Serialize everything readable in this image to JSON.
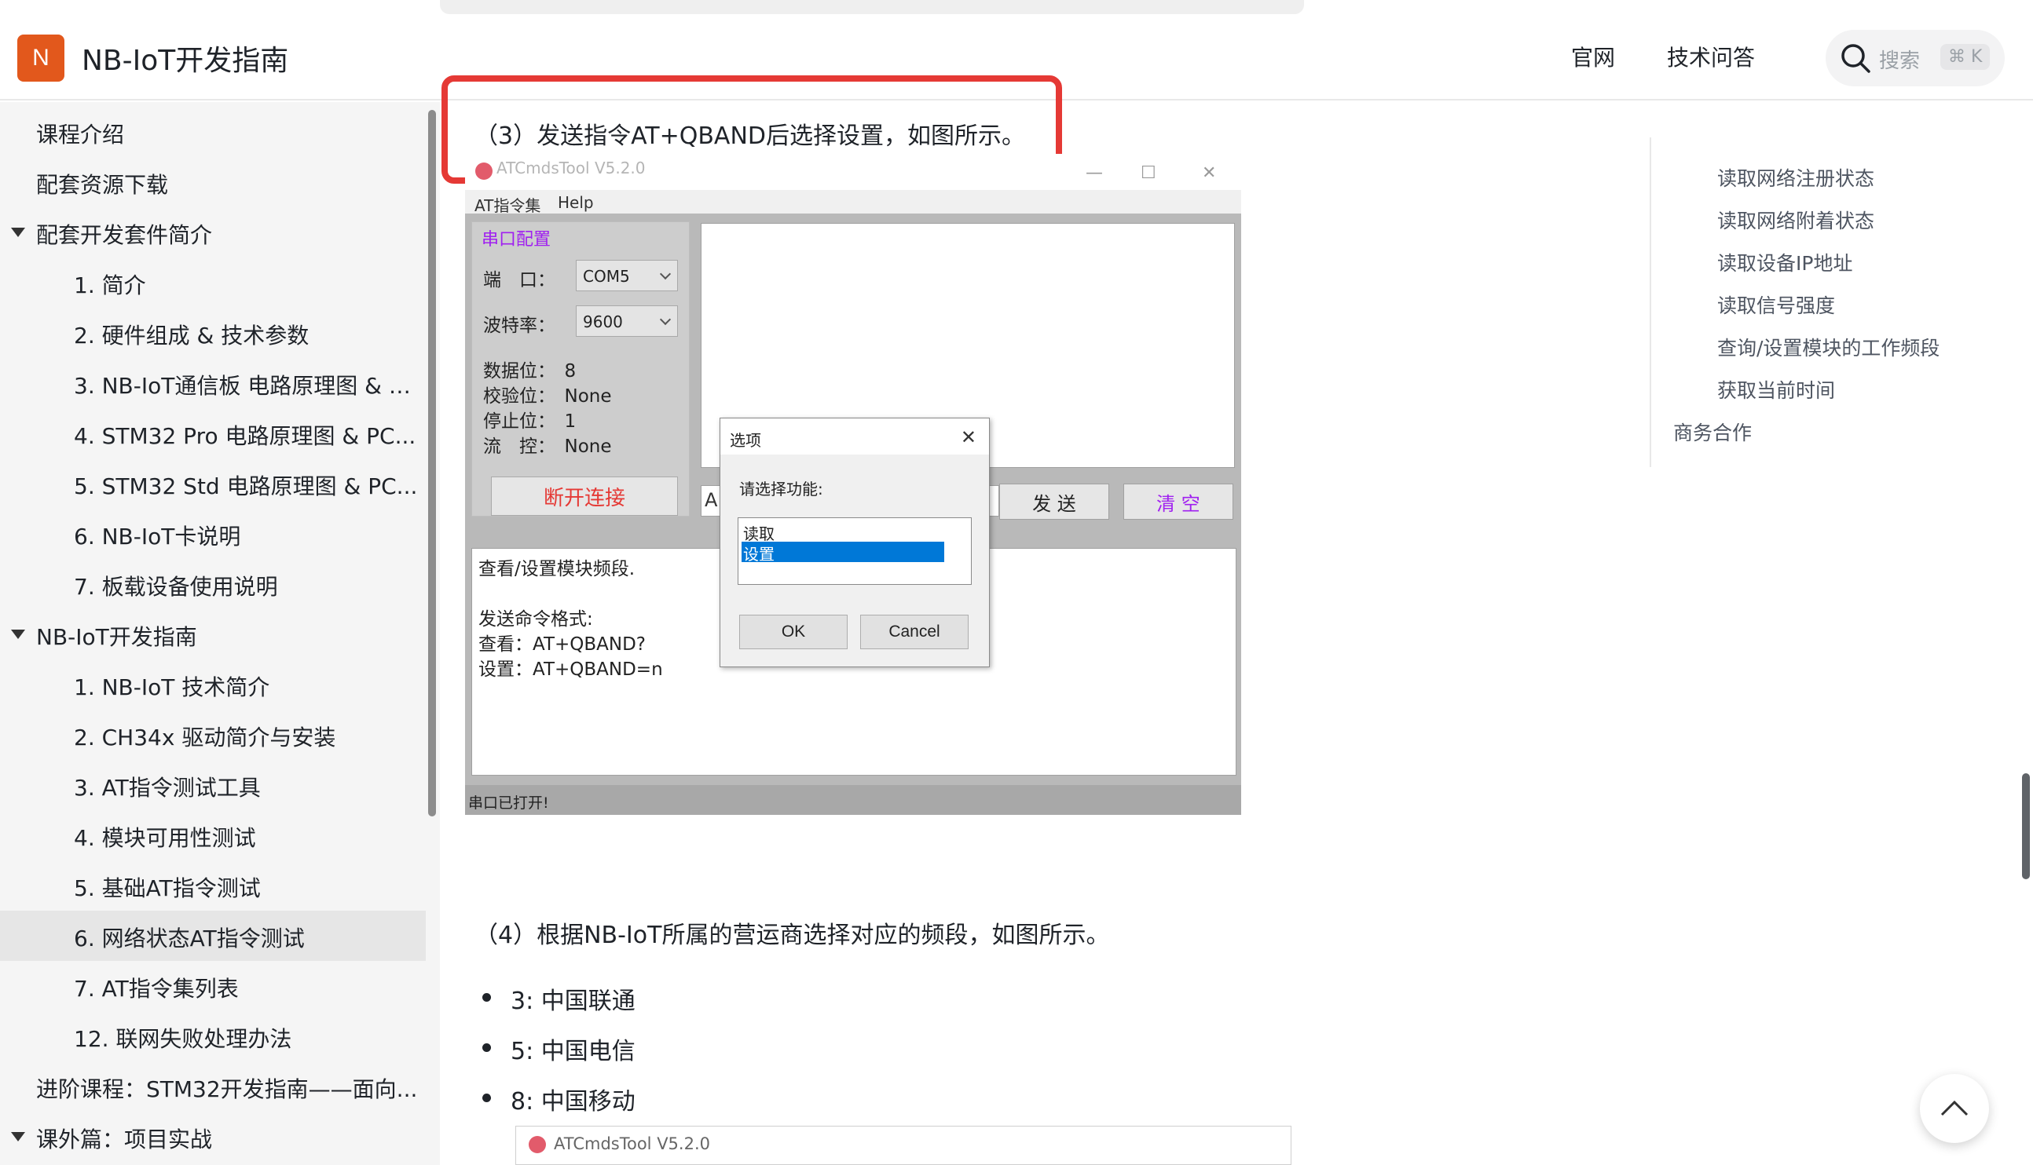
{
  "header": {
    "logo_letter": "N",
    "title": "NB-IoT开发指南",
    "nav": [
      "官网",
      "技术问答"
    ],
    "search_placeholder": "搜索",
    "search_shortcut": "⌘ K"
  },
  "sidebar": {
    "items": [
      {
        "label": "课程介绍",
        "level": 0
      },
      {
        "label": "配套资源下载",
        "level": 0
      },
      {
        "label": "配套开发套件简介",
        "level": 0,
        "expanded": true
      },
      {
        "label": "1. 简介",
        "level": 1
      },
      {
        "label": "2. 硬件组成 & 技术参数",
        "level": 1
      },
      {
        "label": "3. NB-IoT通信板 电路原理图 & P...",
        "level": 1
      },
      {
        "label": "4. STM32 Pro 电路原理图 & PC...",
        "level": 1
      },
      {
        "label": "5. STM32 Std 电路原理图 & PC...",
        "level": 1
      },
      {
        "label": "6. NB-IoT卡说明",
        "level": 1
      },
      {
        "label": "7. 板载设备使用说明",
        "level": 1
      },
      {
        "label": "NB-IoT开发指南",
        "level": 0,
        "expanded": true
      },
      {
        "label": "1. NB-IoT 技术简介",
        "level": 1
      },
      {
        "label": "2. CH34x 驱动简介与安装",
        "level": 1
      },
      {
        "label": "3. AT指令测试工具",
        "level": 1
      },
      {
        "label": "4. 模块可用性测试",
        "level": 1
      },
      {
        "label": "5. 基础AT指令测试",
        "level": 1
      },
      {
        "label": "6. 网络状态AT指令测试",
        "level": 1,
        "active": true
      },
      {
        "label": "7. AT指令集列表",
        "level": 1
      },
      {
        "label": "12. 联网失败处理办法",
        "level": 1
      },
      {
        "label": "进阶课程：STM32开发指南——面向...",
        "level": 0
      },
      {
        "label": "课外篇：项目实战",
        "level": 0,
        "expanded": true
      }
    ]
  },
  "content": {
    "step3": "（3）发送指令AT+QBAND后选择设置，如图所示。",
    "step4": "（4）根据NB-IoT所属的营运商选择对应的频段，如图所示。",
    "bullets": [
      "3: 中国联通",
      "5: 中国电信",
      "8: 中国移动"
    ]
  },
  "toc": {
    "items": [
      "读取网络注册状态",
      "读取网络附着状态",
      "读取设备IP地址",
      "读取信号强度",
      "查询/设置模块的工作频段",
      "获取当前时间"
    ],
    "top_item": "商务合作"
  },
  "app": {
    "title": "ATCmdsTool V5.2.0",
    "menu": [
      "AT指令集",
      "Help"
    ],
    "group_label": "串口配置",
    "port_label": "端　口：",
    "port_value": "COM5",
    "baud_label": "波特率：",
    "baud_value": "9600",
    "databits": "数据位：　8",
    "parity": "校验位：　None",
    "stopbits": "停止位：　1",
    "flow": "流　控：　None",
    "disconnect": "断开连接",
    "cmd_prefix": "A",
    "send": "发 送",
    "clear": "清 空",
    "help_lines": [
      "查看/设置模块频段.",
      "",
      "发送命令格式:",
      "查看：AT+QBAND?",
      "设置：AT+QBAND=n"
    ],
    "status": "串口已打开!"
  },
  "dialog": {
    "title": "选项",
    "prompt": "请选择功能:",
    "options": [
      "读取",
      "设置"
    ],
    "selected": "设置",
    "ok": "OK",
    "cancel": "Cancel"
  },
  "shot2": {
    "title": "ATCmdsTool  V5.2.0"
  },
  "colors": {
    "accent": "#e2581c",
    "highlight": "#e53935",
    "selection": "#0078d7",
    "purple": "#a020f0"
  }
}
